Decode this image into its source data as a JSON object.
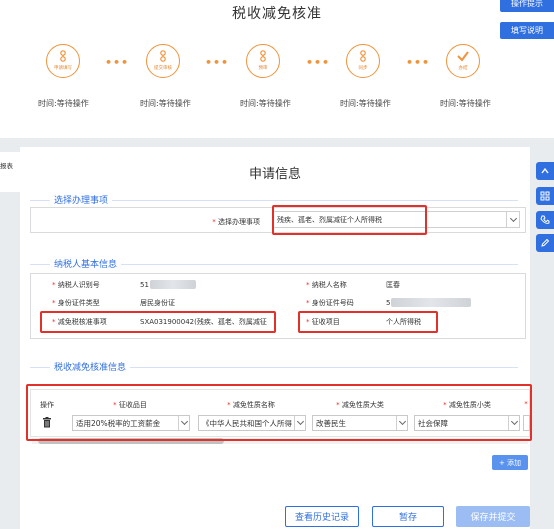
{
  "header": {
    "title": "税收减免核准",
    "operation_hint_btn": "操作提示",
    "fill_guide_btn": "填写说明"
  },
  "steps": [
    {
      "label": "申请填写",
      "time": "时间:等待操作",
      "icon": "flow-icon"
    },
    {
      "label": "提交审核",
      "time": "时间:等待操作",
      "icon": "flow-icon"
    },
    {
      "label": "预审",
      "time": "时间:等待操作",
      "icon": "flow-icon"
    },
    {
      "label": "同步",
      "time": "时间:等待操作",
      "icon": "flow-icon"
    },
    {
      "label": "办结",
      "time": "时间:等待操作",
      "icon": "check-icon"
    }
  ],
  "left_tab": "报表",
  "main": {
    "title": "申请信息",
    "section_select": {
      "title": "选择办理事项",
      "label": "选择办理事项",
      "value": "残疾、孤老、烈属减征个人所得税"
    },
    "section_taxpayer": {
      "title": "纳税人基本信息",
      "rows": [
        {
          "l_label": "纳税人识别号",
          "l_value": "51",
          "r_label": "纳税人名称",
          "r_value": "匡春"
        },
        {
          "l_label": "身份证件类型",
          "l_value": "居民身份证",
          "r_label": "身份证件号码",
          "r_value": "5"
        },
        {
          "l_label": "减免税核准事项",
          "l_value": "SXA031900042(残疾、孤老、烈属减征",
          "r_label": "征收项目",
          "r_value": "个人所得税"
        }
      ]
    },
    "section_approval": {
      "title": "税收减免核准信息",
      "headers": [
        "操作",
        "征收品目",
        "减免性质名称",
        "减免性质大类",
        "减免性质小类"
      ],
      "row": {
        "item": "适用20%税率的工资薪金",
        "nature_name": "《中华人民共和国个人所得",
        "nature_major": "改善民生",
        "nature_minor": "社会保障"
      },
      "add_label": "+ 添加"
    }
  },
  "footer": {
    "history_btn": "查看历史记录",
    "save_btn": "暂存",
    "submit_btn": "保存并提交"
  },
  "colors": {
    "accent": "#2f6fe0",
    "step_orange": "#f0933a",
    "highlight_red": "#e0322b"
  }
}
